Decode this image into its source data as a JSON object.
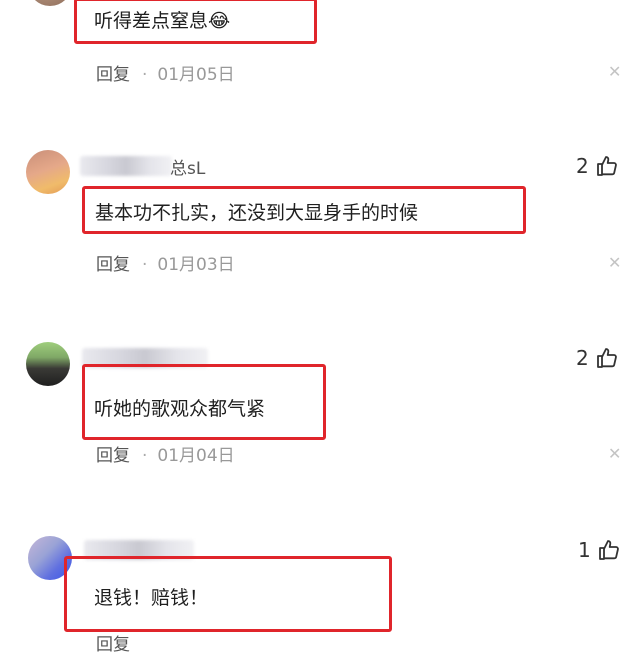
{
  "comments": [
    {
      "text": "听得差点窒息",
      "emoji": "😂",
      "reply_label": "回复",
      "dot": "·",
      "date": "01月05日",
      "close_icon": "close-icon"
    },
    {
      "name_tail": "总sL",
      "likes": "2",
      "text": "基本功不扎实，还没到大显身手的时候",
      "reply_label": "回复",
      "dot": "·",
      "date": "01月03日",
      "close_icon": "close-icon"
    },
    {
      "likes": "2",
      "text": "听她的歌观众都气紧",
      "reply_label": "回复",
      "dot": "·",
      "date": "01月04日",
      "close_icon": "close-icon"
    },
    {
      "likes": "1",
      "text": "退钱！赔钱！",
      "reply_label": "回复"
    }
  ],
  "colors": {
    "highlight_border": "#e0252b",
    "date_text": "#999999"
  },
  "icons": {
    "like": "thumbs-up-icon",
    "close": "close-icon"
  }
}
